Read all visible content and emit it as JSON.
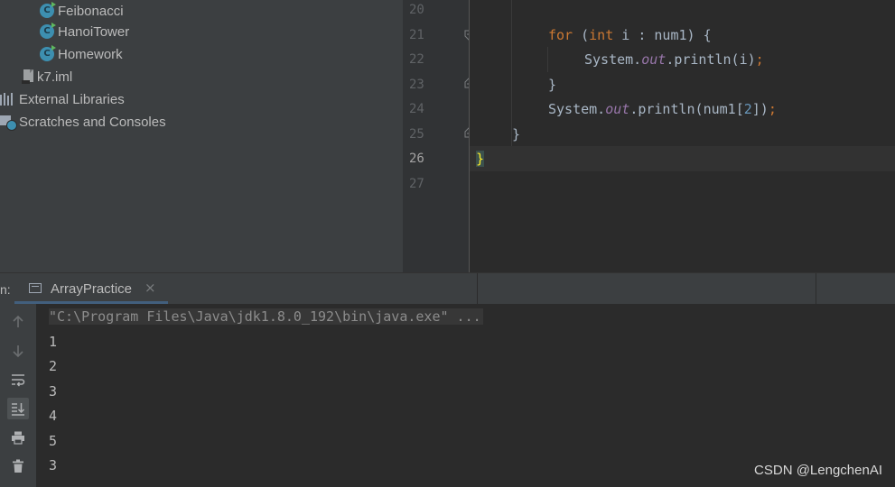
{
  "project_tree": {
    "items": [
      {
        "label": "Feibonacci",
        "icon": "java-class-run-icon"
      },
      {
        "label": "HanoiTower",
        "icon": "java-class-run-icon"
      },
      {
        "label": "Homework",
        "icon": "java-class-run-icon"
      },
      {
        "label": "k7.iml",
        "icon": "iml-file-icon"
      },
      {
        "label": "External Libraries",
        "icon": "libraries-icon"
      },
      {
        "label": "Scratches and Consoles",
        "icon": "scratches-icon"
      }
    ]
  },
  "editor": {
    "line_numbers": [
      "20",
      "21",
      "22",
      "23",
      "24",
      "25",
      "26",
      "27"
    ],
    "current_line": "26",
    "code": {
      "l21": {
        "kw1": "for",
        "p1": " (",
        "kw2": "int",
        "p2": " i : num1) {"
      },
      "l22": {
        "p1": "System.",
        "fld": "out",
        "p2": ".println(i)",
        "semi": ";"
      },
      "l23": {
        "p1": "}"
      },
      "l24": {
        "p1": "System.",
        "fld": "out",
        "p2": ".println(num1[",
        "num": "2",
        "p3": "])",
        "semi": ";"
      },
      "l25": {
        "p1": "}"
      },
      "l26": {
        "p1": "}"
      }
    }
  },
  "run_panel": {
    "label": "n:",
    "tab_label": "ArrayPractice",
    "tab_close": "×",
    "console_command": "\"C:\\Program Files\\Java\\jdk1.8.0_192\\bin\\java.exe\" ...",
    "output_lines": [
      "1",
      "2",
      "3",
      "4",
      "5",
      "3"
    ]
  },
  "toolbar_icons": [
    "arrow-up-icon",
    "arrow-down-icon",
    "soft-wrap-icon",
    "scroll-to-end-icon",
    "print-icon",
    "trash-icon"
  ],
  "watermark": "CSDN @LengchenAI",
  "colors": {
    "keyword": "#cc7832",
    "field": "#9876aa",
    "number": "#6897bb",
    "brace_match": "#ffef28"
  }
}
